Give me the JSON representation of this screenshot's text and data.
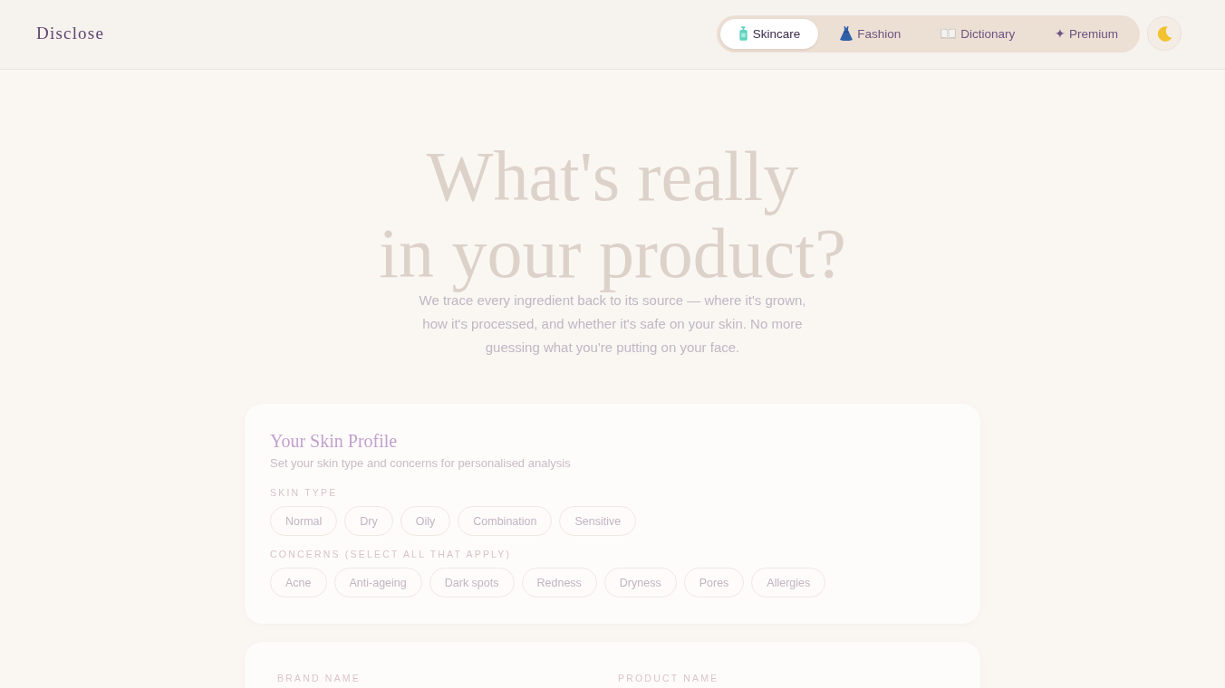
{
  "header": {
    "logo": "Disclose",
    "nav": [
      {
        "label": "Skincare",
        "selected": true
      },
      {
        "label": "Fashion",
        "selected": false
      },
      {
        "label": "Dictionary",
        "selected": false
      },
      {
        "label": "✦ Premium",
        "selected": false
      }
    ]
  },
  "hero": {
    "heading_lines": [
      "What's really",
      "in your product?"
    ],
    "subtitle": "We trace every ingredient back to its source — where it's grown, how it's processed, and whether it's safe on your skin. No more guessing what you're putting on your face."
  },
  "skin_profile": {
    "title": "Your Skin Profile",
    "subtitle": "Set your skin type and concerns for personalised analysis",
    "skin_type": {
      "label": "SKIN TYPE",
      "options": [
        {
          "label": "Normal",
          "selected": false
        },
        {
          "label": "Dry",
          "selected": false
        },
        {
          "label": "Oily",
          "selected": false
        },
        {
          "label": "Combination",
          "selected": false
        },
        {
          "label": "Sensitive",
          "selected": false
        }
      ]
    },
    "concerns": {
      "label": "CONCERNS (SELECT ALL THAT APPLY)",
      "options": [
        {
          "label": "Acne",
          "selected": false
        },
        {
          "label": "Anti-ageing",
          "selected": false
        },
        {
          "label": "Dark spots",
          "selected": false
        },
        {
          "label": "Redness",
          "selected": false
        },
        {
          "label": "Dryness",
          "selected": false
        },
        {
          "label": "Pores",
          "selected": false
        },
        {
          "label": "Allergies",
          "selected": false
        }
      ]
    }
  },
  "product_form": {
    "fields": [
      {
        "label": "BRAND NAME"
      },
      {
        "label": "PRODUCT NAME"
      }
    ]
  }
}
